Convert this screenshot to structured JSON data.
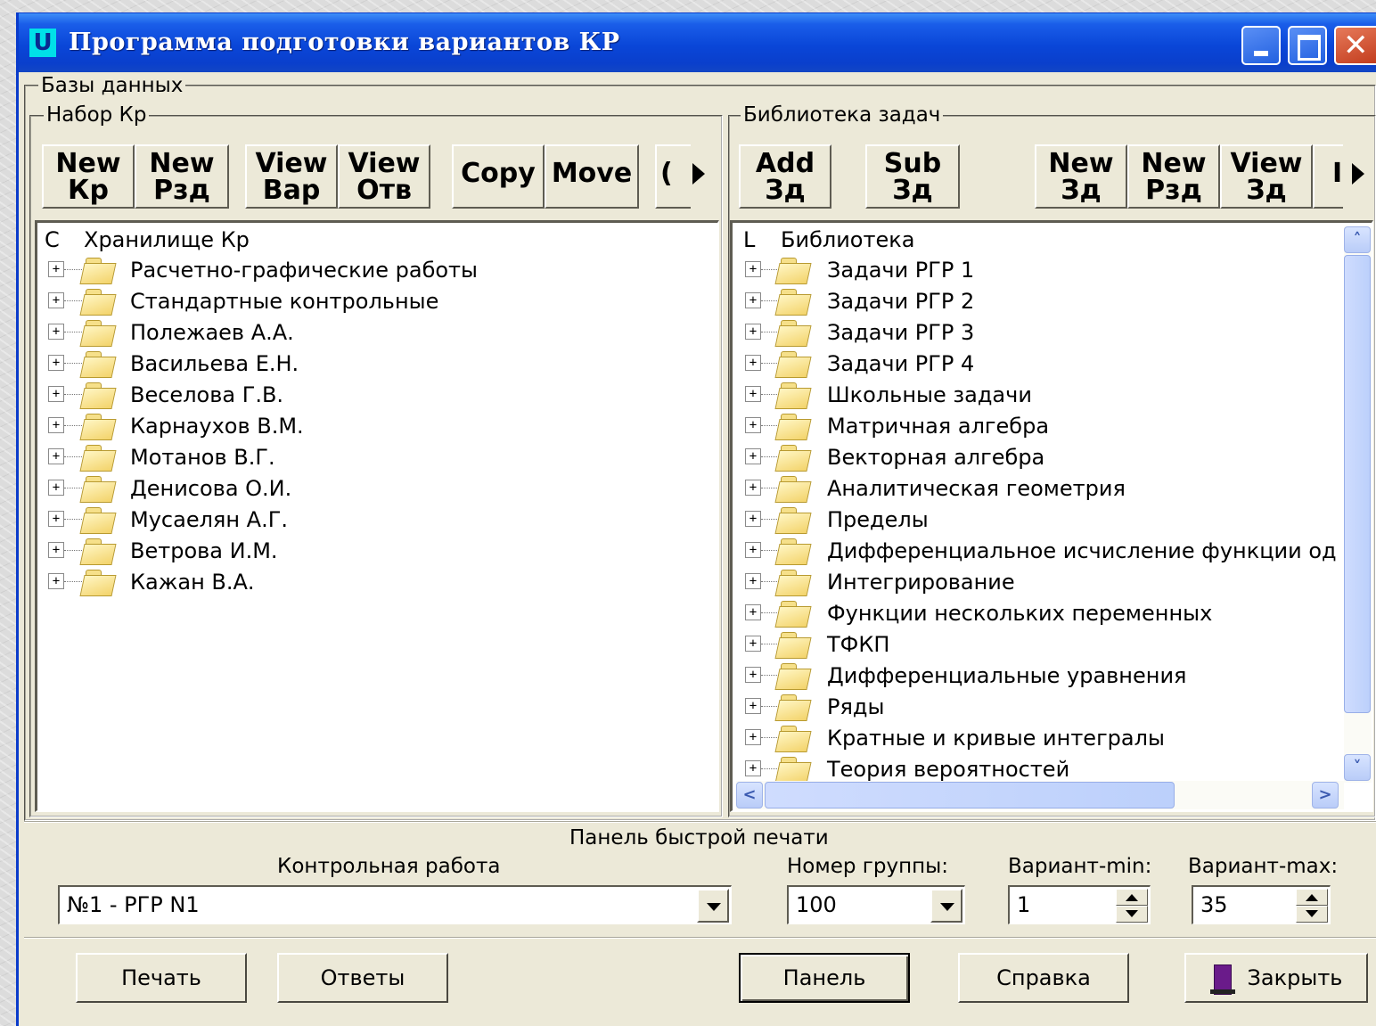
{
  "window": {
    "title": "Программа подготовки вариантов КР",
    "app_icon_letter": "U"
  },
  "databases_label": "Базы данных",
  "left_panel": {
    "title": "Набор Кр",
    "toolbar": [
      {
        "line1": "New",
        "line2": "Кр"
      },
      {
        "line1": "New",
        "line2": "Рзд"
      },
      {
        "line1": "View",
        "line2": "Вар"
      },
      {
        "line1": "View",
        "line2": "Отв"
      },
      {
        "line1": "Copy",
        "line2": ""
      },
      {
        "line1": "Move",
        "line2": ""
      },
      {
        "line1": "(",
        "line2": ""
      }
    ],
    "tree_root_glyph": "С",
    "tree_root": "Хранилище Кр",
    "tree_items": [
      "Расчетно-графические работы",
      "Стандартные контрольные",
      "Полежаев А.А.",
      "Васильева Е.Н.",
      "Веселова Г.В.",
      "Карнаухов В.М.",
      "Мотанов В.Г.",
      "Денисова О.И.",
      "Мусаелян А.Г.",
      "Ветрова И.М.",
      "Кажан В.А."
    ]
  },
  "right_panel": {
    "title": "Библиотека задач",
    "toolbar": [
      {
        "line1": "Add",
        "line2": "Зд"
      },
      {
        "line1": "Sub",
        "line2": "Зд"
      },
      {
        "line1": "New",
        "line2": "Зд"
      },
      {
        "line1": "New",
        "line2": "Рзд"
      },
      {
        "line1": "View",
        "line2": "Зд"
      },
      {
        "line1": "I",
        "line2": ""
      }
    ],
    "tree_root_glyph": "L",
    "tree_root": "Библиотека",
    "tree_items": [
      " Задачи РГР 1",
      "Задачи РГР 2",
      "Задачи РГР 3",
      " Задачи РГР 4",
      "Школьные задачи",
      " Матричная алгебра",
      "Векторная алгебра",
      "Аналитическая геометрия",
      "Пределы",
      "Дифференциальное исчисление функции од",
      "Интегрирование",
      "Функции нескольких переменных",
      "ТФКП",
      "Дифференциальные уравнения",
      "Ряды",
      "Кратные и кривые интегралы",
      "Теория вероятностей"
    ]
  },
  "print_panel": {
    "title": "Панель быстрой печати",
    "work_label": "Контрольная работа",
    "work_value": "№1 -  РГР N1",
    "group_label": "Номер группы:",
    "group_value": "100",
    "var_min_label": "Вариант-min:",
    "var_min_value": "1",
    "var_max_label": "Вариант-max:",
    "var_max_value": "35"
  },
  "buttons": {
    "print": "Печать",
    "answers": "Ответы",
    "panel": "Панель",
    "help": "Справка",
    "close": "Закрыть"
  },
  "colors": {
    "titlebar": "#0a46d8",
    "window_bg": "#ece9d8",
    "app_icon": "#00e0e8"
  }
}
